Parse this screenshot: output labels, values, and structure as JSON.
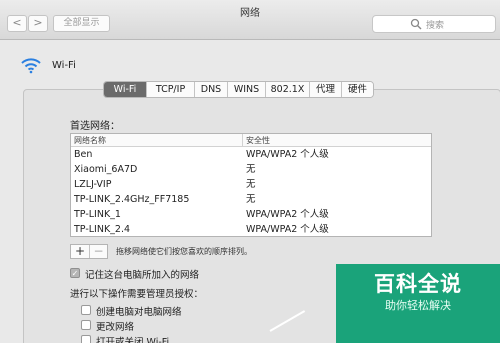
{
  "window": {
    "title": "网络"
  },
  "toolbar": {
    "back": "<",
    "forward": ">",
    "show_all": "全部显示"
  },
  "search": {
    "placeholder": "搜索"
  },
  "header": {
    "service": "Wi-Fi"
  },
  "tabs": [
    {
      "label": "Wi-Fi",
      "active": true
    },
    {
      "label": "TCP/IP",
      "active": false
    },
    {
      "label": "DNS",
      "active": false
    },
    {
      "label": "WINS",
      "active": false
    },
    {
      "label": "802.1X",
      "active": false
    },
    {
      "label": "代理",
      "active": false
    },
    {
      "label": "硬件",
      "active": false
    }
  ],
  "preferred": {
    "label": "首选网络：",
    "columns": {
      "name": "网络名称",
      "security": "安全性"
    },
    "rows": [
      {
        "name": "Ben",
        "security": "WPA/WPA2 个人级"
      },
      {
        "name": "Xiaomi_6A7D",
        "security": "无"
      },
      {
        "name": "LZLJ-VIP",
        "security": "无"
      },
      {
        "name": "TP-LINK_2.4GHz_FF7185",
        "security": "无"
      },
      {
        "name": "TP-LINK_1",
        "security": "WPA/WPA2 个人级"
      },
      {
        "name": "TP-LINK_2.4",
        "security": "WPA/WPA2 个人级"
      }
    ],
    "add": "+",
    "remove": "−",
    "hint": "拖移网络使它们按您喜欢的顺序排列。"
  },
  "remember": {
    "label": "记住这台电脑所加入的网络",
    "checked": true
  },
  "admin": {
    "label": "进行以下操作需要管理员授权：",
    "options": [
      {
        "label": "创建电脑对电脑网络",
        "checked": false
      },
      {
        "label": "更改网络",
        "checked": false
      },
      {
        "label": "打开或关闭 Wi-Fi",
        "checked": false
      }
    ]
  },
  "watermark": {
    "title": "百科全说",
    "subtitle": "助你轻松解决"
  },
  "colors": {
    "accent": "#1aa37a",
    "active_tab": "#6b6b6b",
    "wifi": "#2a7fe0"
  }
}
